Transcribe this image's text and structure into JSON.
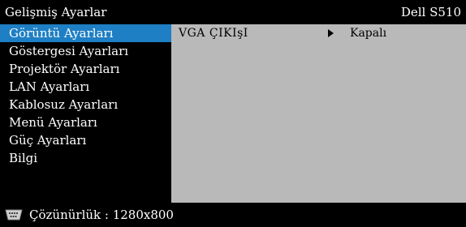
{
  "header": {
    "title": "Gelişmiş Ayarlar",
    "model": "Dell S510"
  },
  "menu": {
    "items": [
      {
        "label": "Görüntü Ayarları",
        "selected": true
      },
      {
        "label": "Göstergesi Ayarları",
        "selected": false
      },
      {
        "label": "Projektör Ayarları",
        "selected": false
      },
      {
        "label": "LAN Ayarları",
        "selected": false
      },
      {
        "label": "Kablosuz Ayarları",
        "selected": false
      },
      {
        "label": "Menü Ayarları",
        "selected": false
      },
      {
        "label": "Güç Ayarları",
        "selected": false
      },
      {
        "label": "Bilgi",
        "selected": false
      }
    ]
  },
  "panel": {
    "rows": [
      {
        "label": "VGA ÇIKIşI",
        "value": "Kapalı"
      }
    ]
  },
  "status": {
    "icon": "vga-connector-icon",
    "text": "Çözünürlük : 1280x800"
  },
  "colors": {
    "background": "#000000",
    "selected": "#1f7fc4",
    "panel": "#b9b9b9"
  }
}
